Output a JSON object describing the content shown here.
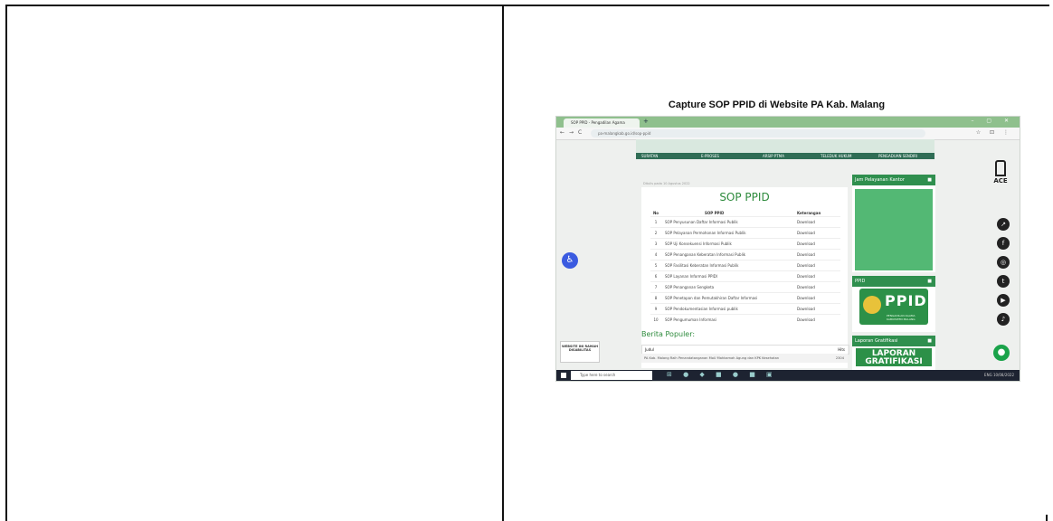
{
  "document": {
    "caption": "Capture SOP PPID di Website PA Kab. Malang"
  },
  "browser": {
    "tab_title": "SOP PPID - Pengadilan Agama",
    "tab_plus": "+",
    "window_controls": "– ▢ ✕",
    "nav_back": "←",
    "nav_forward": "→",
    "nav_reload": "C",
    "url": "pa-malangkab.go.id/sop-ppid",
    "addr_right": "☆ ⊡ ⋮"
  },
  "banner": {
    "labels": [
      "SURATAN",
      "E-PROSES",
      "ARSIP PTMA",
      "TELEDUK HUKUM",
      "PENGADUAN SENDIRI"
    ]
  },
  "page": {
    "meta_line": "Ditulis pada 10 Agustus 2022",
    "sop_title": "SOP PPID",
    "table_headers": {
      "no": "No",
      "name": "SOP PPID",
      "ket": "Keterangan"
    },
    "rows": [
      {
        "no": "1",
        "name": "SOP Penyusunan Daftar Informasi Publik",
        "ket": "Download"
      },
      {
        "no": "2",
        "name": "SOP Pelayanan Permohonan Informasi Publik",
        "ket": "Download"
      },
      {
        "no": "3",
        "name": "SOP Uji Konsekuensi Informasi Publik",
        "ket": "Download"
      },
      {
        "no": "4",
        "name": "SOP Penanganan Keberatan Informasi Publik",
        "ket": "Download"
      },
      {
        "no": "5",
        "name": "SOP Fasilitasi Keberatan Informasi Publik",
        "ket": "Download"
      },
      {
        "no": "6",
        "name": "SOP Layanan Informasi PPIDI",
        "ket": "Download"
      },
      {
        "no": "7",
        "name": "SOP Penanganan Sengketa",
        "ket": "Download"
      },
      {
        "no": "8",
        "name": "SOP Penetapan dan Pemutakhiran Daftar Informasi",
        "ket": "Download"
      },
      {
        "no": "9",
        "name": "SOP Pendokumentasian Informasi publik",
        "ket": "Download"
      },
      {
        "no": "10",
        "name": "SOP Pengumuman Informasi",
        "ket": "Download"
      }
    ],
    "berita_title": "Berita Populer:",
    "judul_label": "Judul",
    "hits_label": "Hits",
    "judul_row": "PA Kab. Malang Raih Penandatanganan MoU Mahkamah Agung dan KPK Kesehatan",
    "judul_hits": "2304"
  },
  "sidebar": {
    "jam_title": "Jam Pelayanan Kantor",
    "ppid_title": "PPID",
    "ppid_logo_text": "PPID",
    "ppid_logo_sub": "PENGADILAN AGAMA KABUPATEN MALANG",
    "laporan_title": "Laporan Gratifikasi",
    "laporan_logo": "LAPORAN GRATIFIKASI",
    "header_icon": "■"
  },
  "widgets": {
    "accessibility_icon": "♿",
    "ace_label": "ACE",
    "social_icons": [
      "↗",
      "f",
      "◎",
      "t",
      "▶",
      "♪"
    ],
    "chat_icon": "●",
    "badge_text": "WEBSITE INI RAMAH DISABILITAS"
  },
  "taskbar": {
    "search_placeholder": "Type here to search",
    "icons": "⊞ ● ◆ ■ ● ■ ▣",
    "tray": "ENG 10/08/2022"
  }
}
